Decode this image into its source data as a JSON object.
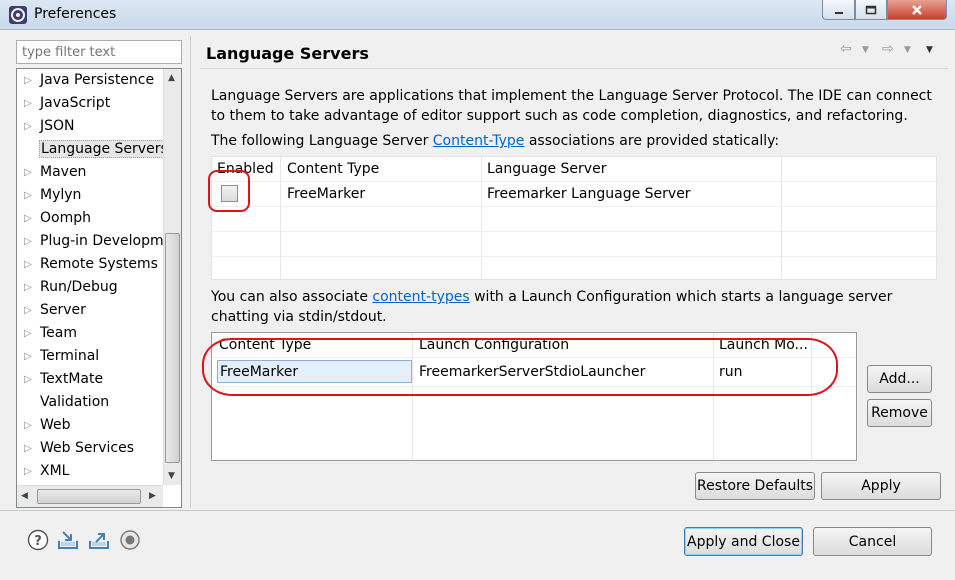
{
  "window": {
    "title": "Preferences"
  },
  "sidebar": {
    "filter_placeholder": "type filter text",
    "items": [
      {
        "label": "Java Persistence",
        "expandable": true
      },
      {
        "label": "JavaScript",
        "expandable": true
      },
      {
        "label": "JSON",
        "expandable": true
      },
      {
        "label": "Language Servers",
        "expandable": false,
        "selected": true
      },
      {
        "label": "Maven",
        "expandable": true
      },
      {
        "label": "Mylyn",
        "expandable": true
      },
      {
        "label": "Oomph",
        "expandable": true
      },
      {
        "label": "Plug-in Developm",
        "expandable": true
      },
      {
        "label": "Remote Systems",
        "expandable": true
      },
      {
        "label": "Run/Debug",
        "expandable": true
      },
      {
        "label": "Server",
        "expandable": true
      },
      {
        "label": "Team",
        "expandable": true
      },
      {
        "label": "Terminal",
        "expandable": true
      },
      {
        "label": "TextMate",
        "expandable": true
      },
      {
        "label": "Validation",
        "expandable": false
      },
      {
        "label": "Web",
        "expandable": true
      },
      {
        "label": "Web Services",
        "expandable": true
      },
      {
        "label": "XML",
        "expandable": true
      }
    ]
  },
  "page": {
    "title": "Language Servers",
    "intro": "Language Servers are applications that implement the Language Server Protocol. The IDE can connect to them to take advantage of editor support such as code completion, diagnostics, and refactoring.",
    "static_text_before": "The following Language Server ",
    "static_link": "Content-Type",
    "static_text_after": " associations are provided statically:",
    "static_table": {
      "headers": [
        "Enabled",
        "Content Type",
        "Language Server"
      ],
      "rows": [
        {
          "enabled": false,
          "content_type": "FreeMarker",
          "language_server": "Freemarker Language Server"
        }
      ]
    },
    "assoc_text_before": "You can also associate ",
    "assoc_link": "content-types",
    "assoc_text_after": " with a Launch Configuration which starts a language server chatting via stdin/stdout.",
    "launch_table": {
      "headers": [
        "Content Type",
        "Launch Configuration",
        "Launch Mo..."
      ],
      "rows": [
        {
          "content_type": "FreeMarker",
          "launch_configuration": "FreemarkerServerStdioLauncher",
          "mode": "run"
        }
      ]
    },
    "buttons": {
      "add": "Add...",
      "remove": "Remove",
      "restore_defaults": "Restore Defaults",
      "apply": "Apply"
    }
  },
  "footer": {
    "apply_and_close": "Apply and Close",
    "cancel": "Cancel",
    "icons": [
      "help-icon",
      "import-icon",
      "export-icon",
      "record-icon"
    ]
  },
  "colors": {
    "link": "#0066cc",
    "annotation": "#e0121b"
  }
}
